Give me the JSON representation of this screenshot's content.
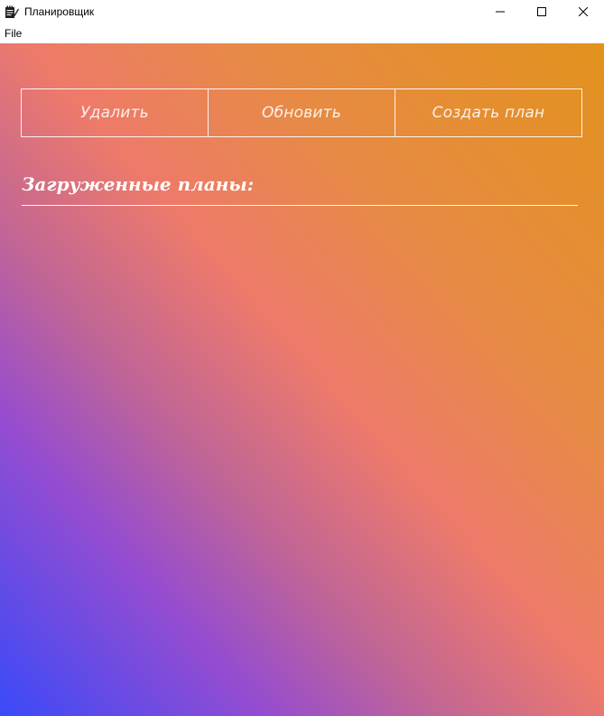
{
  "window": {
    "title": "Планировщик",
    "icon": "notepad-pencil-icon",
    "controls": [
      "minimize-icon",
      "maximize-icon",
      "close-icon"
    ]
  },
  "menubar": {
    "items": [
      {
        "label": "File"
      }
    ]
  },
  "toolbar": {
    "delete_label": "Удалить",
    "refresh_label": "Обновить",
    "create_label": "Создать план"
  },
  "main": {
    "section_title": "Загруженные планы:"
  },
  "colors": {
    "gradient_bottom_left": "#3a4af8",
    "gradient_mid": "#ee7a6a",
    "gradient_top_right": "#e2921d",
    "text": "#ffffff"
  }
}
